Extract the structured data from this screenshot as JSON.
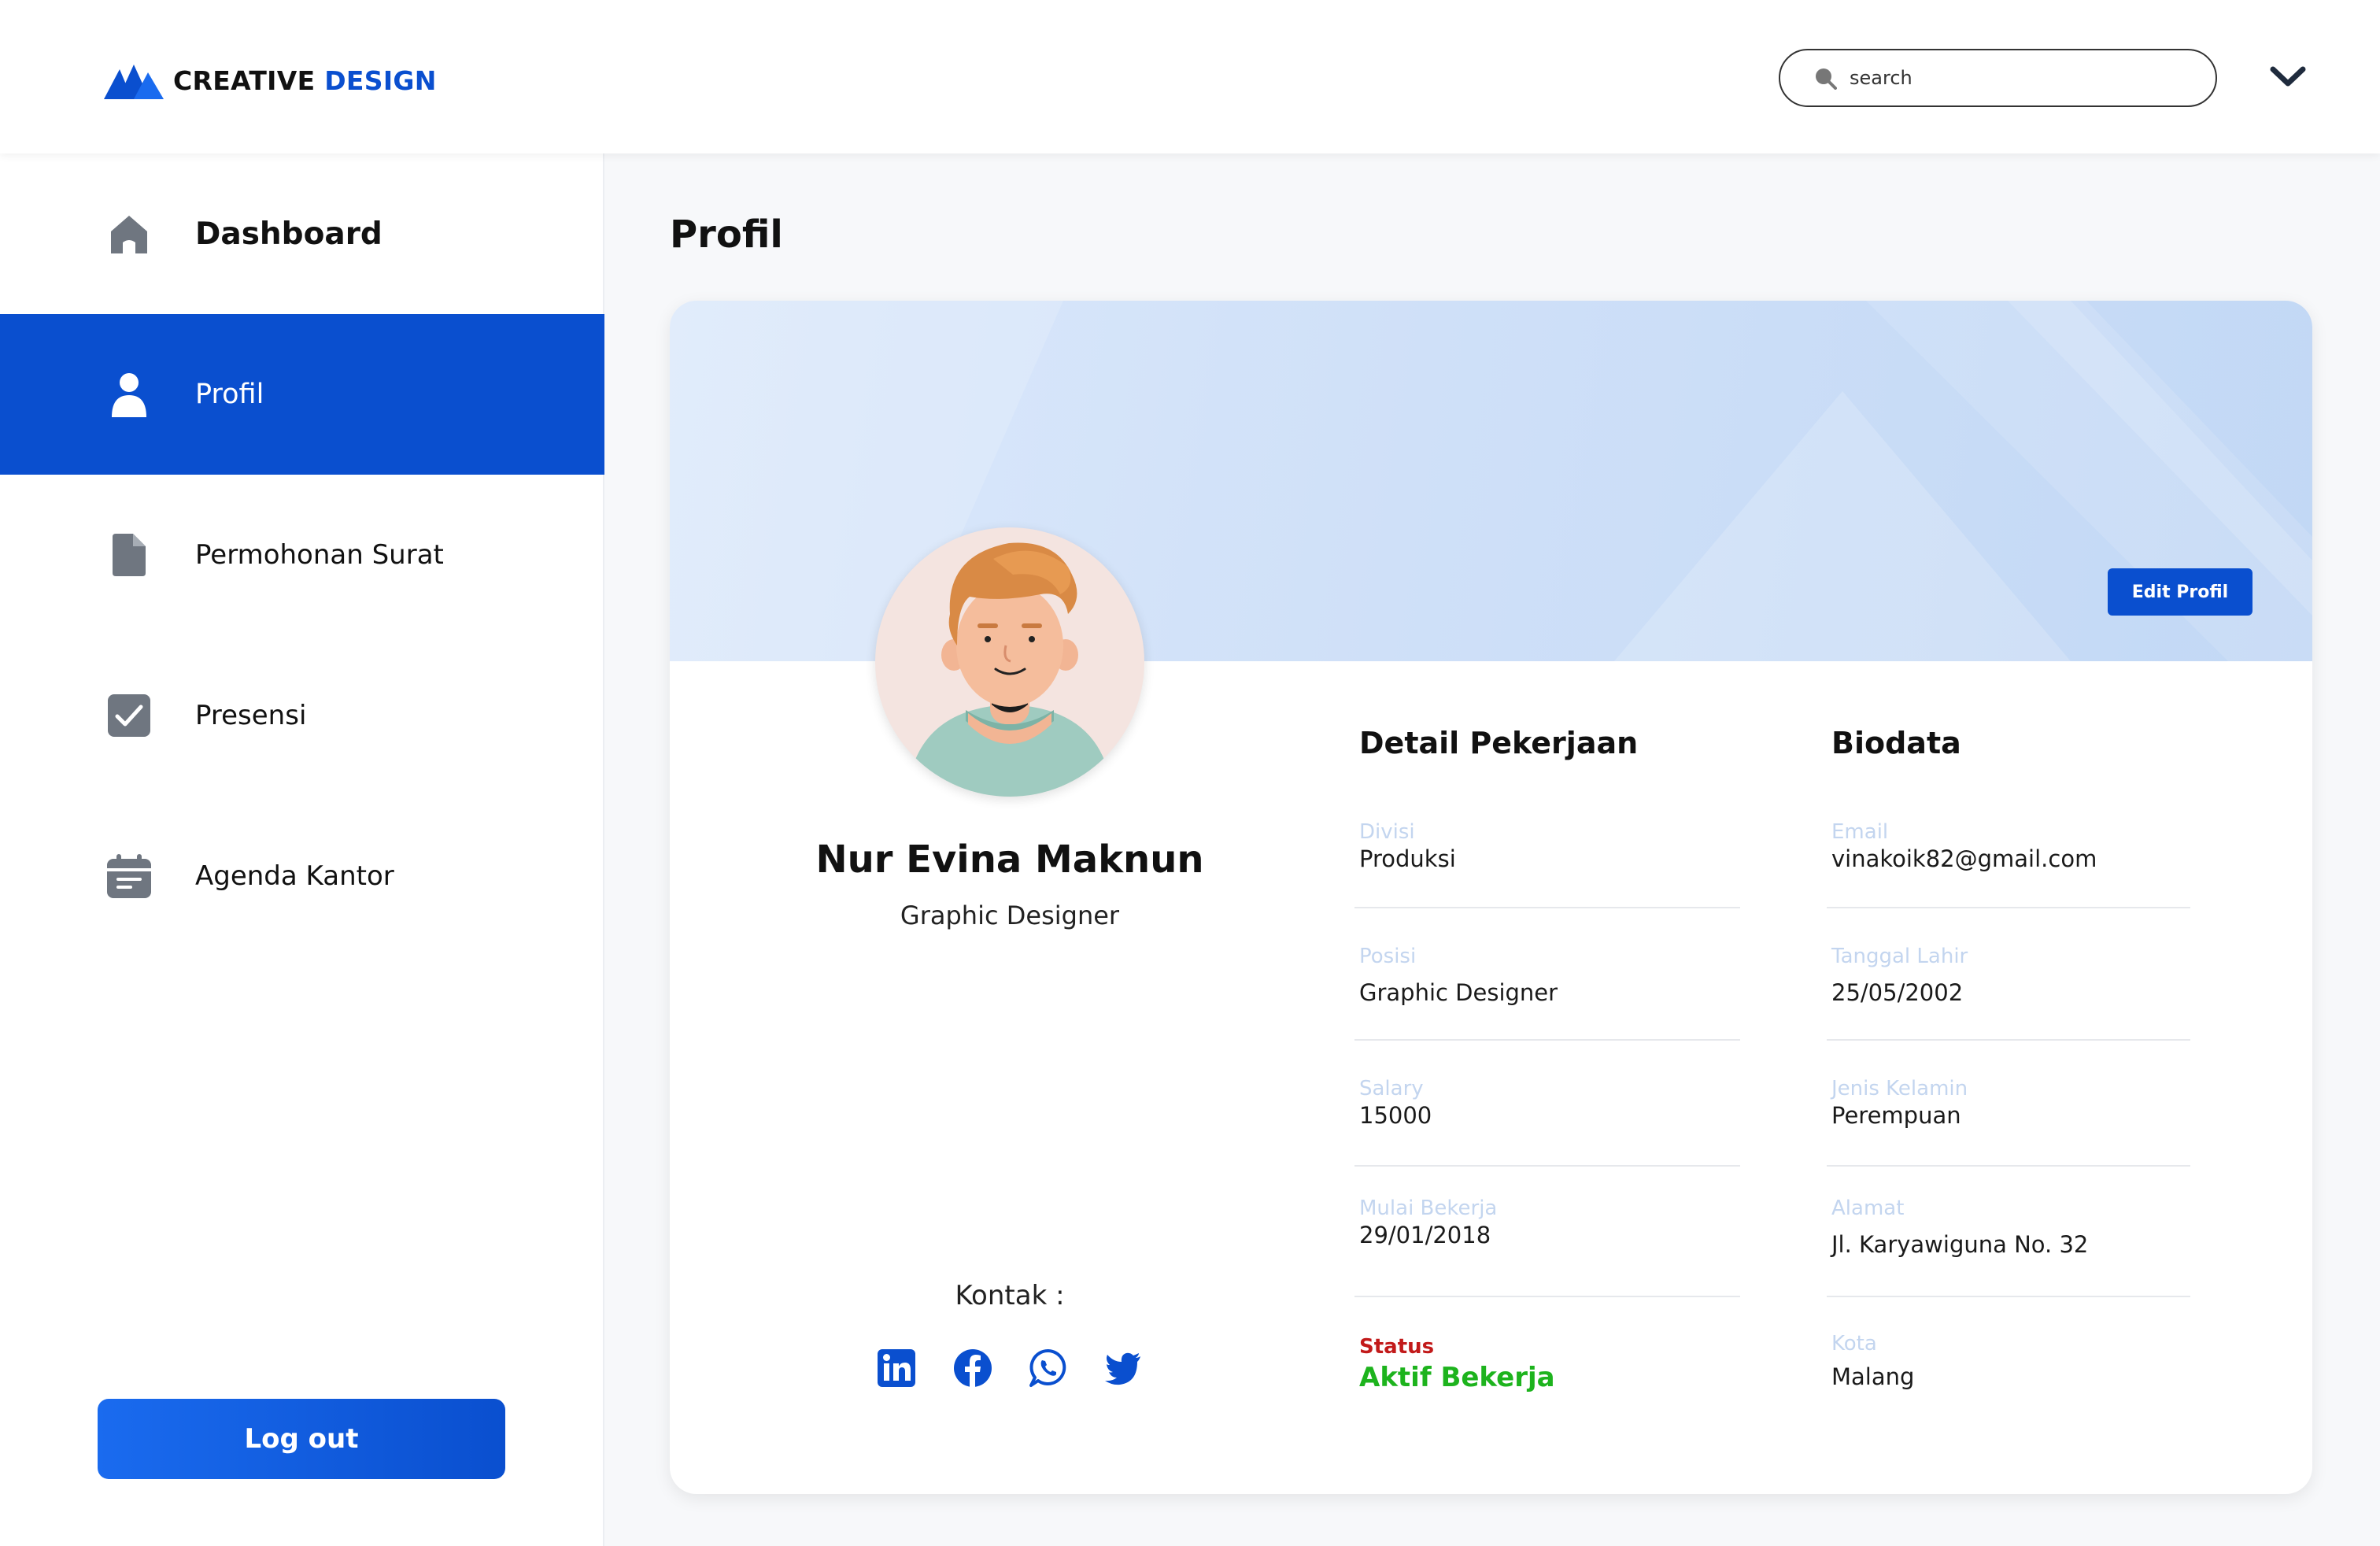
{
  "brand": {
    "word1": "CREATIVE",
    "word2": "DESIGN",
    "accent": "#0a4fcf"
  },
  "header": {
    "search": {
      "placeholder": "search",
      "icon": "search-icon"
    },
    "menu_icon": "chevron-down-icon"
  },
  "sidebar": {
    "items": [
      {
        "label": "Dashboard",
        "icon": "home-icon",
        "active": false
      },
      {
        "label": "Profil",
        "icon": "user-icon",
        "active": true
      },
      {
        "label": "Permohonan Surat",
        "icon": "document-icon",
        "active": false
      },
      {
        "label": "Presensi",
        "icon": "checkbox-icon",
        "active": false
      },
      {
        "label": "Agenda Kantor",
        "icon": "calendar-icon",
        "active": false
      }
    ],
    "logout_label": "Log out"
  },
  "main": {
    "title": "Profil",
    "edit_label": "Edit Profil",
    "profile": {
      "name": "Nur Evina Maknun",
      "role": "Graphic Designer",
      "kontak_label": "Kontak :",
      "socials": [
        "linkedin-icon",
        "facebook-icon",
        "whatsapp-icon",
        "twitter-icon"
      ]
    },
    "detail": {
      "title": "Detail Pekerjaan",
      "fields": [
        {
          "label": "Divisi",
          "value": "Produksi"
        },
        {
          "label": "Posisi",
          "value": "Graphic Designer"
        },
        {
          "label": "Salary",
          "value": "15000"
        },
        {
          "label": "Mulai Bekerja",
          "value": "29/01/2018"
        }
      ],
      "status_label": "Status",
      "status_value": "Aktif Bekerja"
    },
    "biodata": {
      "title": "Biodata",
      "fields": [
        {
          "label": "Email",
          "value": "vinakoik82@gmail.com"
        },
        {
          "label": "Tanggal Lahir",
          "value": "25/05/2002"
        },
        {
          "label": "Jenis Kelamin",
          "value": "Perempuan"
        },
        {
          "label": "Alamat",
          "value": "Jl. Karyawiguna No. 32"
        },
        {
          "label": "Kota",
          "value": "Malang"
        }
      ]
    }
  },
  "colors": {
    "primary": "#0a4fcf",
    "status_active": "#1db31d",
    "status_label": "#c21a1a"
  }
}
